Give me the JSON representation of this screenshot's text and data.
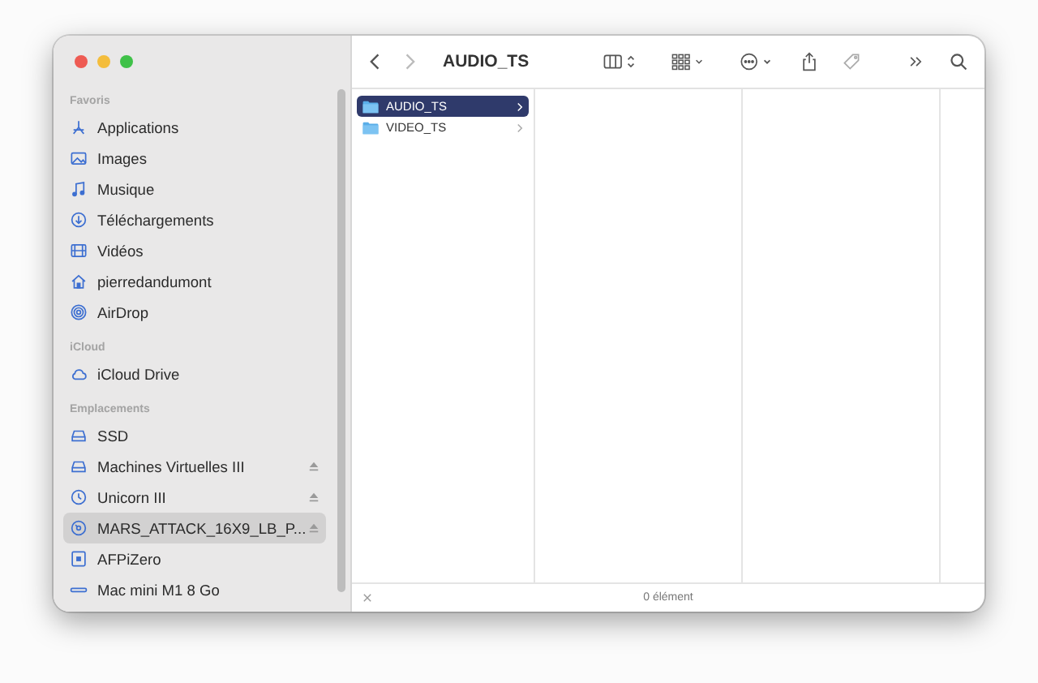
{
  "window": {
    "title": "AUDIO_TS"
  },
  "sidebar": {
    "sections": [
      {
        "header": "Favoris",
        "items": [
          {
            "label": "Applications",
            "kind": "apps",
            "selected": false,
            "eject": false
          },
          {
            "label": "Images",
            "kind": "image",
            "selected": false,
            "eject": false
          },
          {
            "label": "Musique",
            "kind": "music",
            "selected": false,
            "eject": false
          },
          {
            "label": "Téléchargements",
            "kind": "download",
            "selected": false,
            "eject": false
          },
          {
            "label": "Vidéos",
            "kind": "film",
            "selected": false,
            "eject": false
          },
          {
            "label": "pierredandumont",
            "kind": "home",
            "selected": false,
            "eject": false
          },
          {
            "label": "AirDrop",
            "kind": "airdrop",
            "selected": false,
            "eject": false
          }
        ]
      },
      {
        "header": "iCloud",
        "items": [
          {
            "label": "iCloud Drive",
            "kind": "cloud",
            "selected": false,
            "eject": false
          }
        ]
      },
      {
        "header": "Emplacements",
        "items": [
          {
            "label": "SSD",
            "kind": "disk",
            "selected": false,
            "eject": false
          },
          {
            "label": "Machines Virtuelles III",
            "kind": "disk",
            "selected": false,
            "eject": true
          },
          {
            "label": "Unicorn III",
            "kind": "clock",
            "selected": false,
            "eject": true
          },
          {
            "label": "MARS_ATTACK_16X9_LB_P...",
            "kind": "disc",
            "selected": true,
            "eject": true
          },
          {
            "label": "AFPiZero",
            "kind": "server",
            "selected": false,
            "eject": false
          },
          {
            "label": "Mac mini M1 8 Go",
            "kind": "macmini",
            "selected": false,
            "eject": false
          }
        ]
      }
    ]
  },
  "columns": [
    {
      "items": [
        {
          "name": "AUDIO_TS",
          "selected": true
        },
        {
          "name": "VIDEO_TS",
          "selected": false
        }
      ]
    }
  ],
  "status_bar": {
    "text": "0 élément"
  }
}
